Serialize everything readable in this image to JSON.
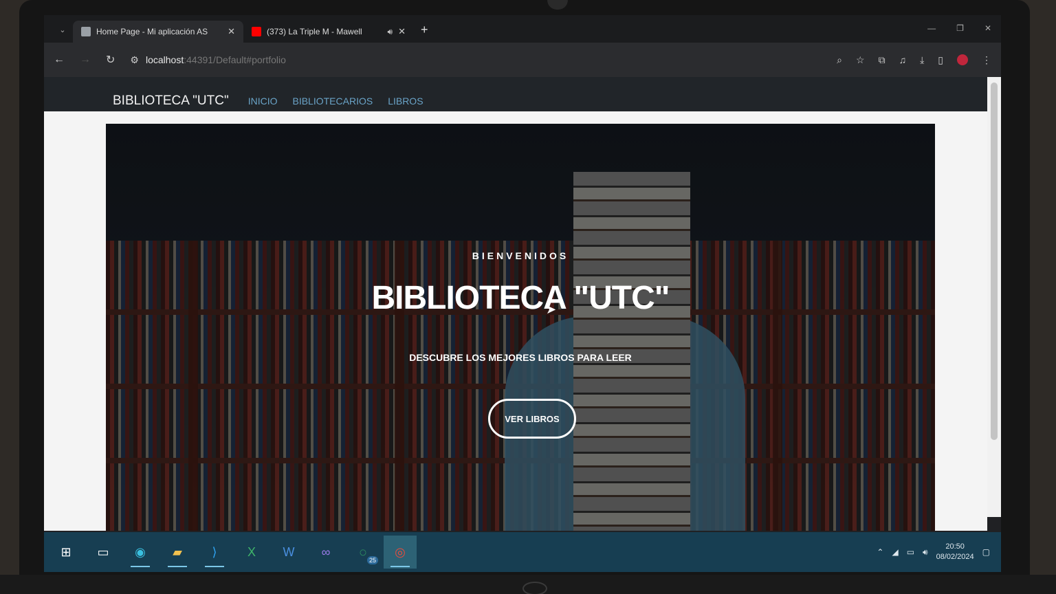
{
  "browser": {
    "tabs": [
      {
        "title": "Home Page - Mi aplicación AS",
        "active": true,
        "favicon_color": "#9aa0a6"
      },
      {
        "title": "(373) La Triple M - Mawell",
        "active": false,
        "favicon_color": "#ff0000"
      }
    ],
    "new_tab_label": "+",
    "url_host": "localhost",
    "url_rest": ":44391/Default#portfolio"
  },
  "site": {
    "brand": "BIBLIOTECA \"UTC\"",
    "nav": [
      {
        "label": "Inicio"
      },
      {
        "label": "Bibliotecarios"
      },
      {
        "label": "Libros"
      }
    ],
    "hero": {
      "kicker": "BIENVENIDOS",
      "title": "BIBLIOTECA \"UTC\"",
      "subtitle": "DESCUBRE LOS MEJORES LIBROS PARA LEER",
      "button": "VER LIBROS"
    }
  },
  "taskbar": {
    "items": [
      {
        "name": "start",
        "icon": "windows-icon",
        "glyph": "⊞"
      },
      {
        "name": "task-view",
        "icon": "task-view-icon",
        "glyph": "▭"
      },
      {
        "name": "edge",
        "icon": "edge-icon",
        "glyph": "◉"
      },
      {
        "name": "explorer",
        "icon": "folder-icon",
        "glyph": "▰"
      },
      {
        "name": "vscode",
        "icon": "vscode-icon",
        "glyph": "⟩"
      },
      {
        "name": "excel",
        "icon": "excel-icon",
        "glyph": "X"
      },
      {
        "name": "word",
        "icon": "word-icon",
        "glyph": "W"
      },
      {
        "name": "visual-studio",
        "icon": "visual-studio-icon",
        "glyph": "∞"
      },
      {
        "name": "whatsapp",
        "icon": "whatsapp-icon",
        "glyph": "◌"
      },
      {
        "name": "chrome",
        "icon": "chrome-icon",
        "glyph": "◎"
      }
    ],
    "whatsapp_badge": "25",
    "time": "20:50",
    "date": "08/02/2024"
  },
  "colors": {
    "navbar": "#212529",
    "navlink": "#6aa4c8",
    "taskbar": "#173e52"
  }
}
